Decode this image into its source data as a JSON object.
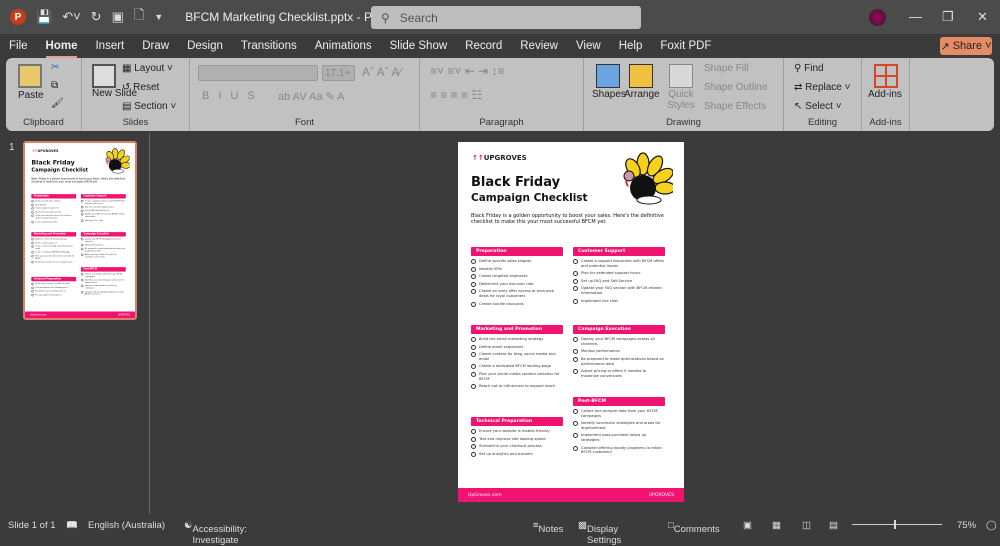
{
  "app": {
    "title": "BFCM Marketing Checklist.pptx  -  PowerPoint",
    "search_placeholder": "Search",
    "share": "Share"
  },
  "tabs": [
    "File",
    "Home",
    "Insert",
    "Draw",
    "Design",
    "Transitions",
    "Animations",
    "Slide Show",
    "Record",
    "Review",
    "View",
    "Help",
    "Foxit PDF"
  ],
  "ribbon": {
    "clipboard": {
      "label": "Clipboard",
      "paste": "Paste"
    },
    "slides": {
      "label": "Slides",
      "new_slide": "New Slide",
      "layout": "Layout",
      "reset": "Reset",
      "section": "Section"
    },
    "font": {
      "label": "Font",
      "size": "17.1+"
    },
    "paragraph": {
      "label": "Paragraph"
    },
    "drawing": {
      "label": "Drawing",
      "shapes": "Shapes",
      "arrange": "Arrange",
      "quick_styles": "Quick Styles",
      "shape_fill": "Shape Fill",
      "shape_outline": "Shape Outline",
      "shape_effects": "Shape Effects"
    },
    "editing": {
      "label": "Editing",
      "find": "Find",
      "replace": "Replace",
      "select": "Select"
    },
    "addins": {
      "label": "Add-ins",
      "button": "Add-ins"
    }
  },
  "thumbnail": {
    "number": "1"
  },
  "slide": {
    "brand": "UPGROVES",
    "title1": "Black Friday",
    "title2": "Campaign Checklist",
    "intro": "Black Friday is a golden opportunity to boost your sales. Here's the definitive checklist to make this your most successful BFCM yet.",
    "left": [
      {
        "heading": "Preparation",
        "items": [
          "Define specific sales targets",
          "Identify KPIs",
          "Create targeted segments",
          "Determine your discount rate",
          "Create an early offer access or exclusive deals for loyal customers",
          "Create bundle discounts"
        ]
      },
      {
        "heading": "Marketing and Promotion",
        "items": [
          "Build the email marketing strategy",
          "Define email sequences",
          "Create content for blog, social media and email",
          "Create a dedicated BFCM landing page",
          "Plan your social media content calendar for BFCM",
          "Reach out to influencers to expand reach"
        ]
      },
      {
        "heading": "Technical Preparation",
        "items": [
          "Ensure your website is mobile-friendly",
          "Test and improve site loading speed",
          "Streamline your checkout process",
          "Set up analytics and trackers"
        ]
      }
    ],
    "right": [
      {
        "heading": "Customer Support",
        "items": [
          "Create a support document with BFCM offers and potential issues",
          "Plan for extended support hours",
          "Set up FAQ and Self-Service",
          "Update your FAQ section with BFCM-related information",
          "Implement live chat"
        ]
      },
      {
        "heading": "Campaign Execution",
        "items": [
          "Deploy your BFCM campaigns across all channels",
          "Monitor performance",
          "Be prepared to make optimizations based on performance data",
          "Adjust pricing or offers if needed to maximize conversions"
        ]
      },
      {
        "heading": "Post-BFCM",
        "items": [
          "Collect and analyze data from your BFCM campaigns",
          "Identify successful strategies and areas for improvement",
          "Implement post-purchase follow up strategies",
          "Consider offering loyalty programs to retain BFCM customers"
        ]
      }
    ],
    "footer_url": "UpGroves.com",
    "footer_brand": "UPGROVES"
  },
  "status": {
    "slide": "Slide 1 of 1",
    "language": "English (Australia)",
    "accessibility": "Accessibility: Investigate",
    "notes": "Notes",
    "display": "Display Settings",
    "comments": "Comments",
    "zoom": "75%"
  },
  "colors": {
    "accent": "#f0136f",
    "share": "#e58c66"
  }
}
